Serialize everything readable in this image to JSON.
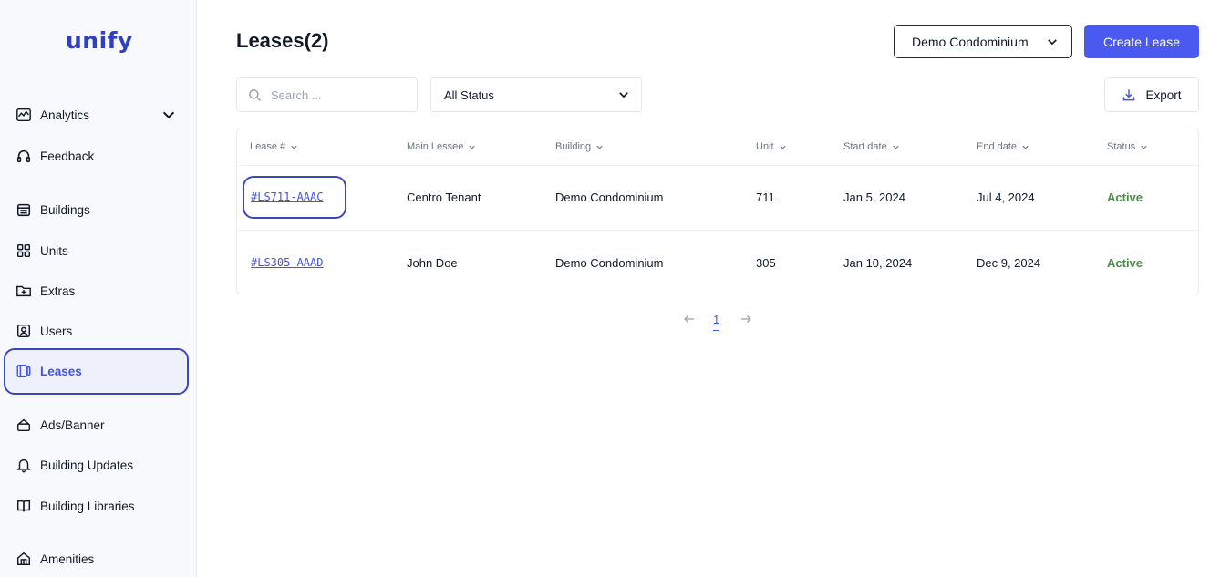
{
  "brand": {
    "logo_text": "unify",
    "accent": "#4a59f0"
  },
  "sidebar": {
    "items": [
      {
        "label": "Analytics",
        "icon": "chart-line-icon",
        "has_chevron": true
      },
      {
        "label": "Feedback",
        "icon": "headset-icon"
      },
      {
        "label": "Buildings",
        "icon": "building-icon"
      },
      {
        "label": "Units",
        "icon": "grid-icon"
      },
      {
        "label": "Extras",
        "icon": "folder-plus-icon"
      },
      {
        "label": "Users",
        "icon": "user-square-icon"
      },
      {
        "label": "Leases",
        "icon": "lease-icon",
        "active": true
      },
      {
        "label": "Ads/Banner",
        "icon": "ad-icon"
      },
      {
        "label": "Building Updates",
        "icon": "bell-icon"
      },
      {
        "label": "Building Libraries",
        "icon": "book-icon"
      },
      {
        "label": "Amenities",
        "icon": "amenities-icon"
      }
    ]
  },
  "header": {
    "title": "Leases(2)",
    "building_select": "Demo Condominium",
    "create_label": "Create Lease"
  },
  "filters": {
    "search_placeholder": "Search ...",
    "status_select": "All Status",
    "export_label": "Export"
  },
  "table": {
    "columns": [
      "Lease #",
      "Main Lessee",
      "Building",
      "Unit",
      "Start date",
      "End date",
      "Status"
    ],
    "rows": [
      {
        "lease": "#LS711-AAAC",
        "lessee": "Centro Tenant",
        "building": "Demo Condominium",
        "unit": "711",
        "start": "Jan 5, 2024",
        "end": "Jul 4, 2024",
        "status": "Active"
      },
      {
        "lease": "#LS305-AAAD",
        "lessee": "John Doe",
        "building": "Demo Condominium",
        "unit": "305",
        "start": "Jan 10, 2024",
        "end": "Dec 9, 2024",
        "status": "Active"
      }
    ]
  },
  "pagination": {
    "current": "1"
  }
}
